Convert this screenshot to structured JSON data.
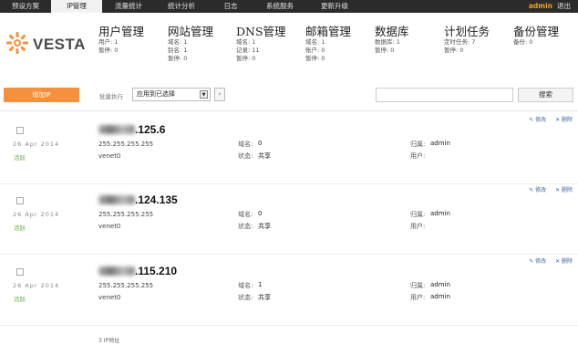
{
  "nav": {
    "items": [
      {
        "label": "预设方案"
      },
      {
        "label": "IP管理"
      },
      {
        "label": "流量统计"
      },
      {
        "label": "统计分析"
      },
      {
        "label": "日志"
      },
      {
        "label": "系统服务"
      },
      {
        "label": "更新升级"
      }
    ],
    "user": "admin",
    "logout": "退出"
  },
  "logo": {
    "text": "VESTA",
    "icon": "vesta-logo-icon"
  },
  "stats": [
    {
      "title": "用户管理",
      "lines": [
        "用户: 1",
        "暂停: 0"
      ]
    },
    {
      "title": "网站管理",
      "lines": [
        "域名: 1",
        "别名: 1",
        "暂停: 0"
      ]
    },
    {
      "title": "DNS管理",
      "lines": [
        "域名: 1",
        "记录: 11",
        "暂停: 0"
      ]
    },
    {
      "title": "邮箱管理",
      "lines": [
        "域名: 1",
        "账户: 0",
        "暂停: 0"
      ]
    },
    {
      "title": "数据库",
      "lines": [
        "数据库: 1",
        "暂停: 0"
      ]
    },
    {
      "title": "计划任务",
      "lines": [
        "定时任务: 7",
        "暂停: 0"
      ]
    },
    {
      "title": "备份管理",
      "lines": [
        "备份: 0"
      ]
    }
  ],
  "toolbar": {
    "add_label": "增加IP",
    "bulk_label": "批量执行",
    "bulk_value": "应用到已选择",
    "apply_label": "›",
    "search_value": "",
    "search_label": "搜索"
  },
  "rows": [
    {
      "ip_suffix": ".125.6",
      "date": "26 Apr 2014",
      "status": "活跃",
      "netmask": "255.255.255.255",
      "iface": "venet0",
      "domains_label": "域名:",
      "domains": "0",
      "state_label": "状态:",
      "state": "共享",
      "owner_label": "归属:",
      "owner": "admin",
      "user_label": "用户:",
      "user": "",
      "edit": "✎ 修改",
      "delete": "✕ 删除"
    },
    {
      "ip_suffix": ".124.135",
      "date": "26 Apr 2014",
      "status": "活跃",
      "netmask": "255.255.255.255",
      "iface": "venet0",
      "domains_label": "域名:",
      "domains": "0",
      "state_label": "状态:",
      "state": "共享",
      "owner_label": "归属:",
      "owner": "admin",
      "user_label": "用户:",
      "user": "",
      "edit": "✎ 修改",
      "delete": "✕ 删除"
    },
    {
      "ip_suffix": ".115.210",
      "date": "26 Apr 2014",
      "status": "活跃",
      "netmask": "255.255.255.255",
      "iface": "venet0",
      "domains_label": "域名:",
      "domains": "1",
      "state_label": "状态:",
      "state": "共享",
      "owner_label": "归属:",
      "owner": "admin",
      "user_label": "用户:",
      "user": "admin",
      "edit": "✎ 修改",
      "delete": "✕ 删除"
    }
  ],
  "footer": {
    "count": "3 IP地址"
  },
  "colors": {
    "accent": "#f5913c",
    "nav_bg": "#2b2b2b",
    "active_status": "#6aa84f",
    "user": "#f0a020"
  }
}
